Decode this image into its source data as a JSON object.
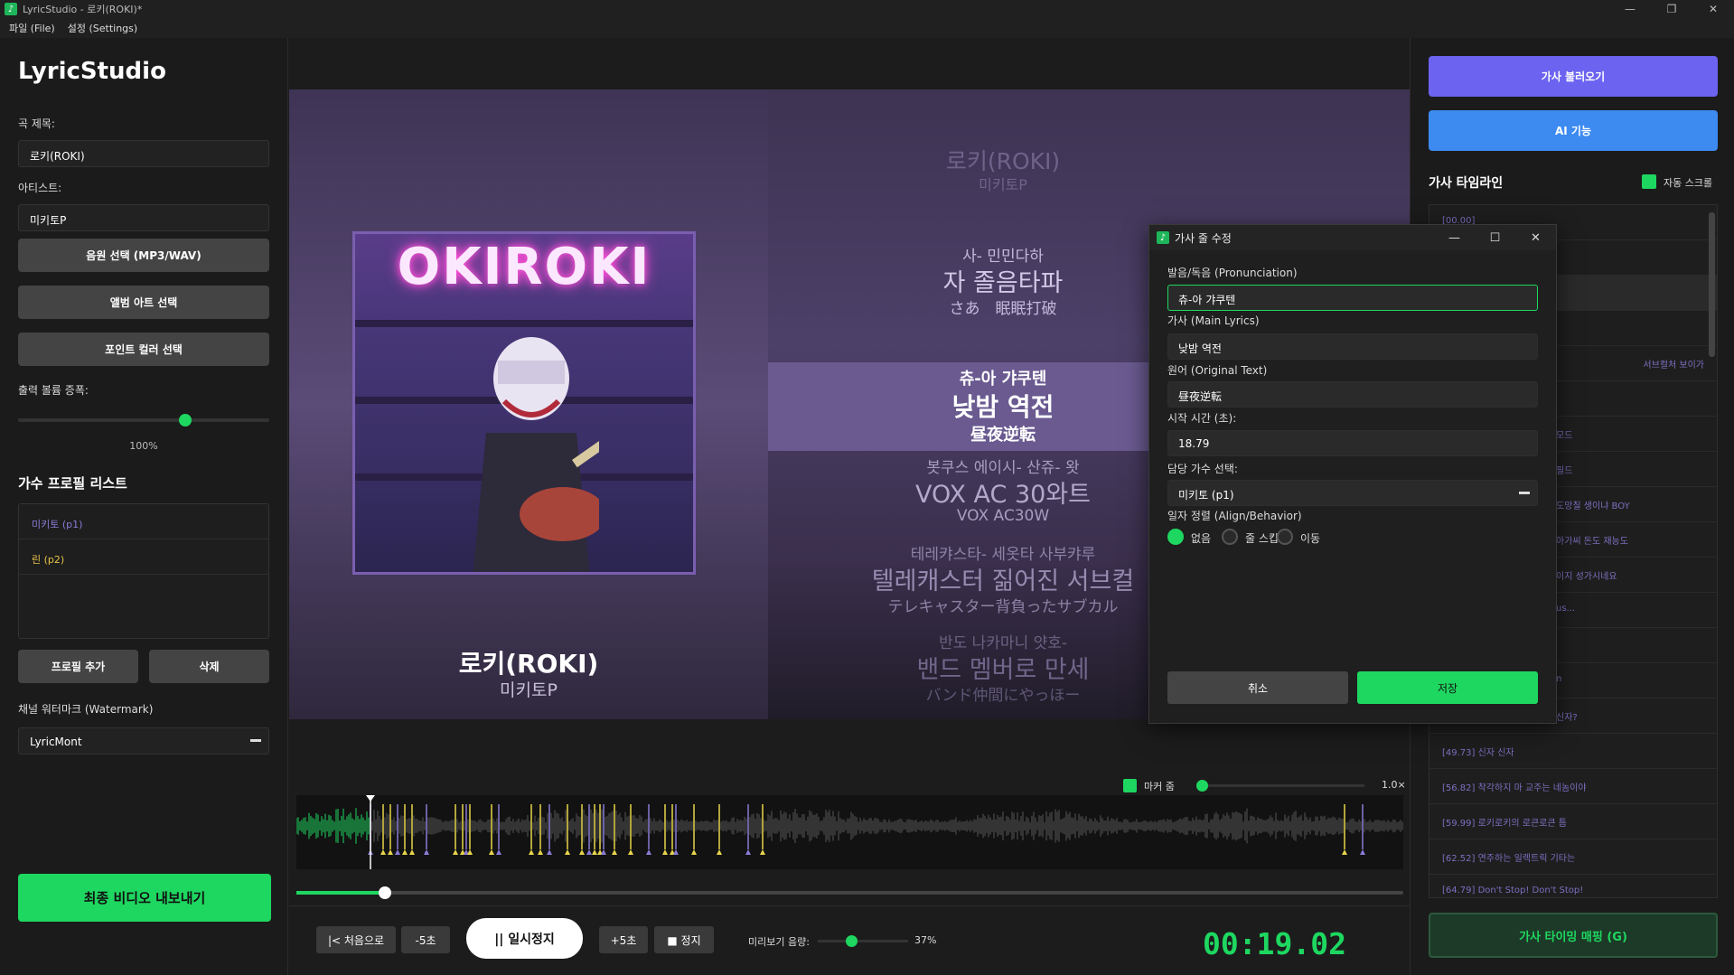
{
  "window": {
    "title": "LyricStudio - 로키(ROKI)*",
    "menu": [
      "파일 (File)",
      "설정 (Settings)"
    ],
    "controls": [
      "—",
      "❐",
      "✕"
    ]
  },
  "left": {
    "brand": "LyricStudio",
    "song_title_label": "곡 제목:",
    "song_title_value": "로키(ROKI)",
    "artist_label": "아티스트:",
    "artist_value": "미키토P",
    "audio_button": "음원 선택 (MP3/WAV)",
    "album_art_button": "앨범 아트 선택",
    "point_color_button": "포인트 컬러 선택",
    "volume_label": "출력 볼륨 증폭:",
    "volume_percent": 100,
    "volume_value": "100%",
    "profiles_heading": "가수 프로필 리스트",
    "profiles": [
      {
        "label": "미키토 (p1)",
        "color": "#8a7bd6"
      },
      {
        "label": "린 (p2)",
        "color": "#e8c44a"
      }
    ],
    "add_profile_button": "프로필 추가",
    "delete_button": "삭제",
    "watermark_label": "채널 워터마크 (Watermark)",
    "watermark_value": "LyricMont",
    "export_button": "최종 비디오 내보내기"
  },
  "preview": {
    "album_art_text": "OKIROKI",
    "song_title": "로키(ROKI)",
    "song_artist": "미키토P",
    "header_title": "로키(ROKI)",
    "header_artist": "미키토P",
    "lines": [
      {
        "pron": "사- 민민다하",
        "main": "자 졸음타파",
        "orig": "さあ　眠眠打破"
      },
      {
        "pron": "츄-아 갸쿠텐",
        "main": "낮밤 역전",
        "orig": "昼夜逆転"
      },
      {
        "pron": "봇쿠스 에이시- 산쥬- 왓",
        "main": "VOX AC 30와트",
        "orig": "VOX AC30W"
      },
      {
        "pron": "테레캬스타- 세옷타 사부캬루",
        "main": "텔레캐스터 짊어진 서브컬",
        "orig": "テレキャスター背負ったサブカル"
      },
      {
        "pron": "반도 나카마니 얏호-",
        "main": "밴드 멤버로 만세",
        "orig": "バンド仲間にやっほー"
      }
    ],
    "marker_zoom_label": "마커 줌",
    "zoom_value": "1.0×",
    "seek_fraction": 0.08
  },
  "controls": {
    "to_start": "|< 처음으로",
    "back5": "-5초",
    "pause": "|| 일시정지",
    "fwd5": "+5초",
    "stop": "■ 정지",
    "preview_volume_label": "미리보기 음량:",
    "preview_volume_percent": 37,
    "preview_volume_value": "37%",
    "timecode": "00:19.02"
  },
  "right": {
    "load_lyrics_button": "가사 불러오기",
    "ai_button": "AI 기능",
    "timeline_heading": "가사 타임라인",
    "auto_scroll_label": "자동 스크롤",
    "timeline_rows": [
      "[00.00]",
      "",
      "",
      "",
      "서브컬처 보이가",
      "",
      "모드",
      "필드",
      "도망칠 생이냐 BOY",
      "아가씨 돈도 재능도",
      "이지 성가시네요",
      "us...",
      "",
      "n",
      "신자?",
      "[49.73] 신자 신자",
      "[56.82] 착각하지 마 교주는 네놈이야",
      "[59.99] 로키로키의 로큰로큰 틈",
      "[62.52] 연주하는 일렉트릭 기타는",
      "[64.79] Don't Stop! Don't Stop!"
    ],
    "mapping_button": "가사 타이밍 매핑 (G)"
  },
  "dialog": {
    "title": "가사 줄 수정",
    "controls": [
      "—",
      "☐",
      "✕"
    ],
    "pron_label": "발음/독음 (Pronunciation)",
    "pron_value": "츄-아 갸쿠텐",
    "main_label": "가사 (Main Lyrics)",
    "main_value": "낮밤 역전",
    "orig_label": "원어 (Original Text)",
    "orig_value": "昼夜逆転",
    "start_label": "시작 시간 (초):",
    "start_value": "18.79",
    "singer_label": "담당 가수 선택:",
    "singer_value": "미키토 (p1)",
    "align_label": "일자 정렬 (Align/Behavior)",
    "align_options": [
      "없음",
      "줄 스킵",
      "이동"
    ],
    "cancel": "취소",
    "save": "저장"
  }
}
